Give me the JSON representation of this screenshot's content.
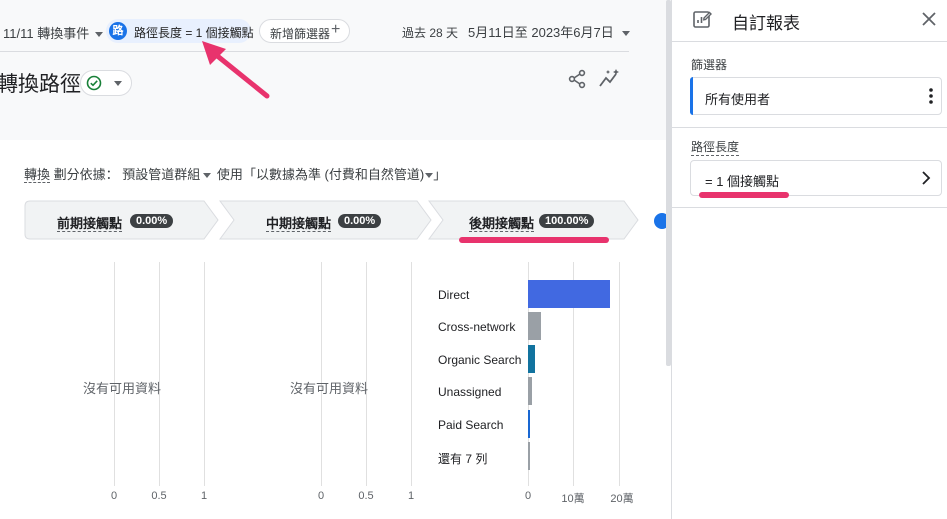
{
  "header": {
    "event_select": "11/11 轉換事件",
    "active_filter_badge": "路",
    "active_filter_label": "路徑長度 = 1 個接觸點",
    "add_filter_label": "新增篩選器",
    "date_period": "過去 28 天",
    "date_range": "5月11日至 2023年6月7日"
  },
  "title": {
    "page_title": "轉換路徑"
  },
  "breakdown": {
    "metric": "轉換",
    "prefix": "劃分依據：",
    "dimension": "預設管道群組",
    "using": "使用",
    "model": "「以數據為準 (付費和自然管道)",
    "suffix": "」"
  },
  "stages": [
    {
      "label": "前期接觸點",
      "pct": "0.00%"
    },
    {
      "label": "中期接觸點",
      "pct": "0.00%"
    },
    {
      "label": "後期接觸點",
      "pct": "100.00%"
    }
  ],
  "charts": {
    "no_data": "沒有可用資料",
    "empty_ticks": [
      "0",
      "0.5",
      "1"
    ],
    "late_ticks": [
      "0",
      "10萬",
      "20萬"
    ]
  },
  "chart_data": {
    "type": "bar",
    "orientation": "horizontal",
    "categories": [
      "Direct",
      "Cross-network",
      "Organic Search",
      "Unassigned",
      "Paid Search",
      "還有 7 列"
    ],
    "values": [
      180000,
      28000,
      15000,
      9000,
      4000,
      1000
    ],
    "colors": [
      "#4169e1",
      "#9aa0a6",
      "#12739f",
      "#9aa0a6",
      "#1967d2",
      "#9aa0a6"
    ],
    "xlim": [
      0,
      200000
    ],
    "xticks": [
      "0",
      "10萬",
      "20萬"
    ]
  },
  "panel": {
    "title": "自訂報表",
    "filters_title": "篩選器",
    "filter_value": "所有使用者",
    "path_title": "路徑長度",
    "path_value": "= 1 個接觸點"
  },
  "colors": {
    "accent": "#1a73e8",
    "annotation": "#e8336d"
  },
  "icons": [
    "chevron-down-icon",
    "plus-icon",
    "check-circle-icon",
    "share-icon",
    "insights-icon",
    "edit-report-icon",
    "close-icon",
    "kebab-menu-icon",
    "chevron-right-icon"
  ]
}
